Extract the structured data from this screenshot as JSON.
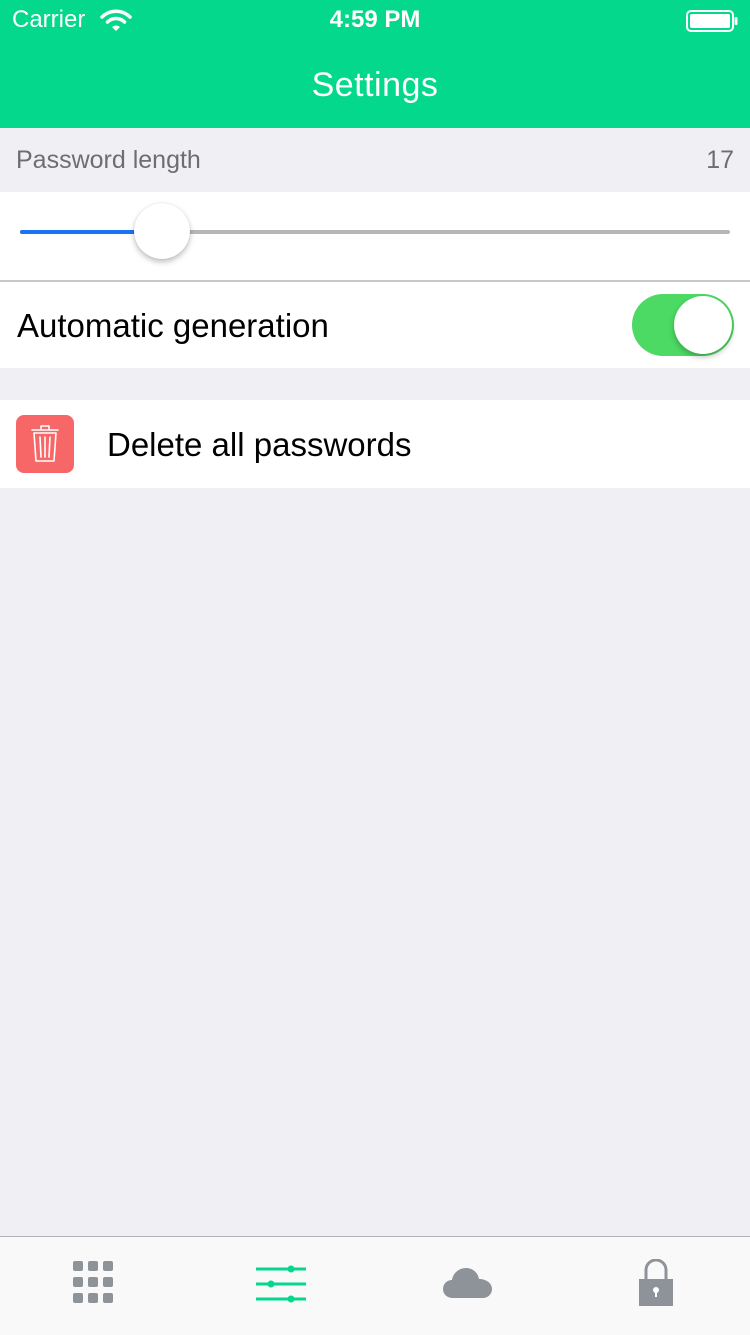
{
  "status_bar": {
    "carrier": "Carrier",
    "time": "4:59 PM"
  },
  "nav": {
    "title": "Settings"
  },
  "password_length": {
    "label": "Password length",
    "value": "17",
    "slider_fraction": 0.2
  },
  "automatic_generation": {
    "label": "Automatic generation",
    "enabled": true
  },
  "delete_all": {
    "label": "Delete all passwords",
    "icon": "trash-icon"
  },
  "tabs": [
    {
      "icon": "grid-icon",
      "selected": false
    },
    {
      "icon": "sliders-icon",
      "selected": true
    },
    {
      "icon": "cloud-icon",
      "selected": false
    },
    {
      "icon": "lock-icon",
      "selected": false
    }
  ],
  "colors": {
    "accent": "#03D88C",
    "slider_fill": "#1A73F0",
    "toggle_on": "#4CD964",
    "delete_icon_bg": "#F86767",
    "tab_inactive": "#8E9399"
  }
}
